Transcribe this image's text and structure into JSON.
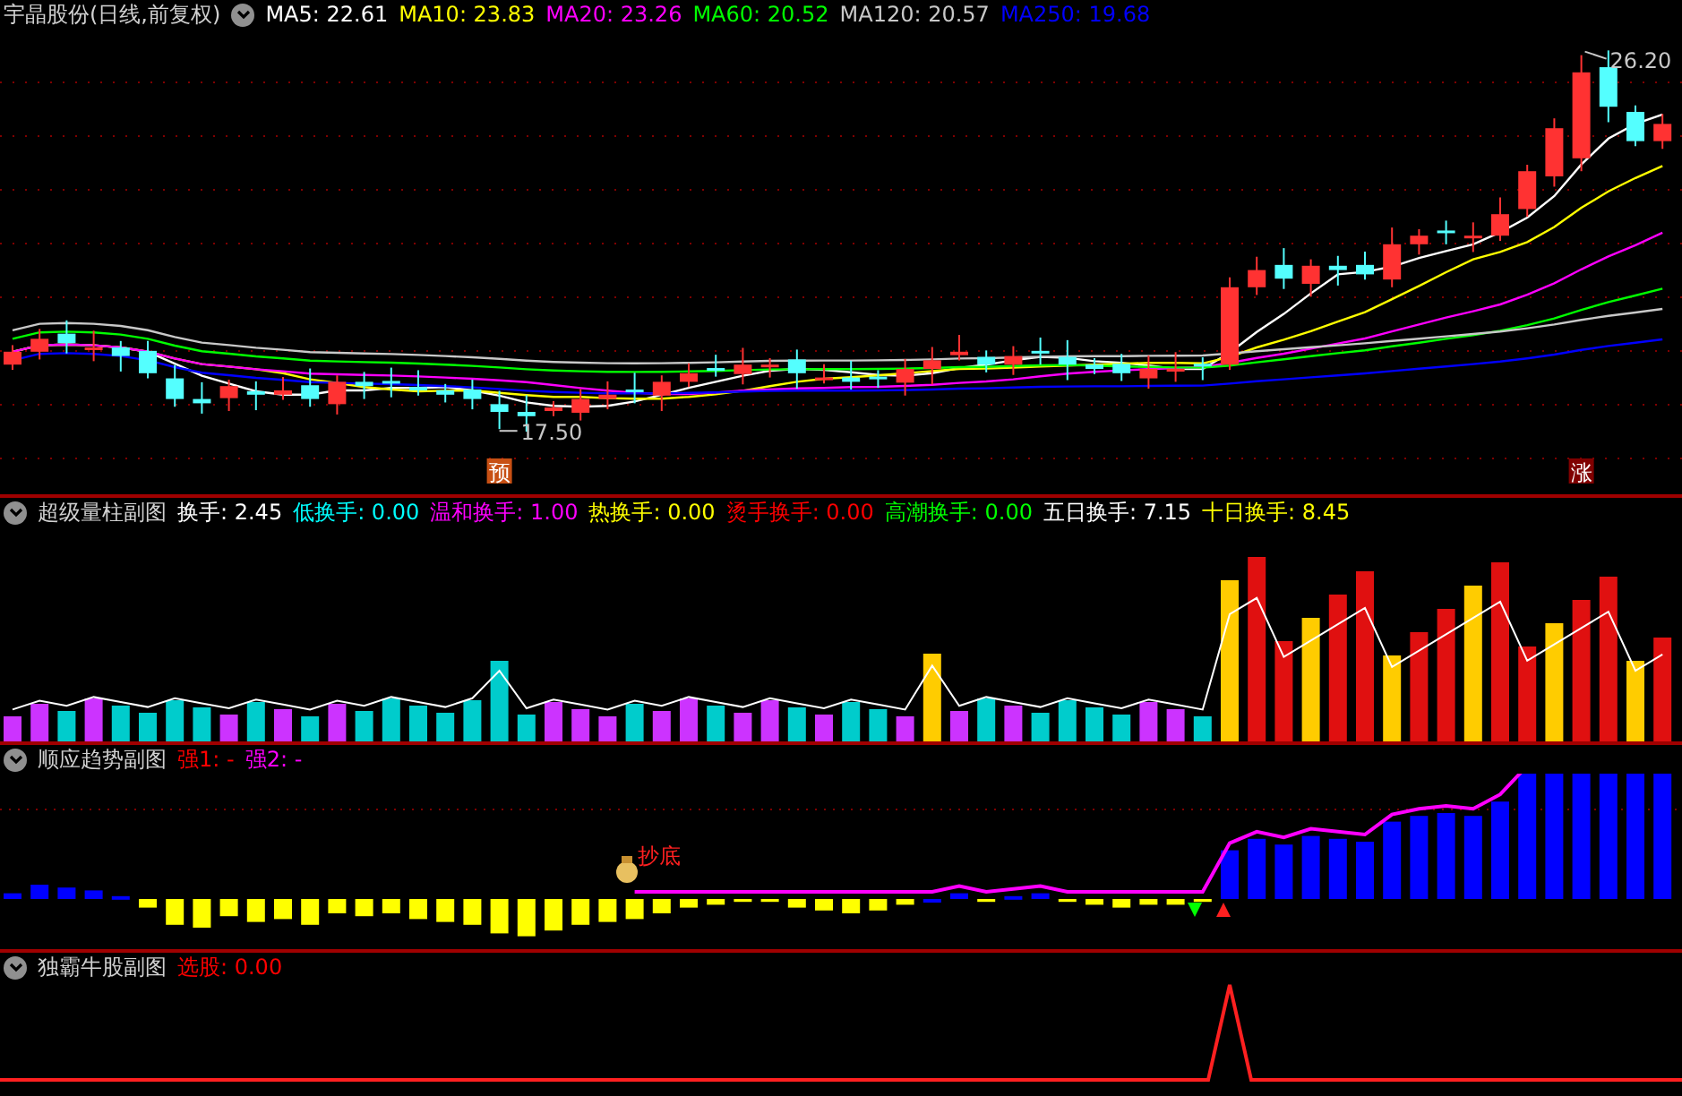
{
  "main_panel": {
    "title": "宇晶股份(日线,前复权)",
    "indicators": [
      {
        "label": "MA5: 22.61",
        "color": "#ffffff"
      },
      {
        "label": "MA10: 23.83",
        "color": "#ffff00"
      },
      {
        "label": "MA20: 23.26",
        "color": "#ff00ff"
      },
      {
        "label": "MA60: 20.52",
        "color": "#00ff00"
      },
      {
        "label": "MA120: 20.57",
        "color": "#c8c8c8"
      },
      {
        "label": "MA250: 19.68",
        "color": "#0000ff"
      }
    ],
    "high_label": "26.20",
    "low_label": "17.50",
    "markers": [
      {
        "text": "预",
        "color": "#c85014"
      },
      {
        "text": "涨",
        "color": "#800000"
      }
    ]
  },
  "sub_panels": [
    {
      "title": "超级量柱副图",
      "readings": [
        {
          "label": "换手: 2.45",
          "color": "#ffffff"
        },
        {
          "label": "低换手: 0.00",
          "color": "#00ffff"
        },
        {
          "label": "温和换手: 1.00",
          "color": "#ff00ff"
        },
        {
          "label": "热换手: 0.00",
          "color": "#ffff00"
        },
        {
          "label": "烫手换手: 0.00",
          "color": "#ff0000"
        },
        {
          "label": "高潮换手: 0.00",
          "color": "#00ff00"
        },
        {
          "label": "五日换手: 7.15",
          "color": "#ffffff"
        },
        {
          "label": "十日换手: 8.45",
          "color": "#ffff00"
        }
      ]
    },
    {
      "title": "顺应趋势副图",
      "readings": [
        {
          "label": "强1: -",
          "color": "#ff0000"
        },
        {
          "label": "强2: -",
          "color": "#ff00ff"
        }
      ],
      "signal_label": "抄底"
    },
    {
      "title": "独霸牛股副图",
      "readings": [
        {
          "label": "选股: 0.00",
          "color": "#ff0000"
        }
      ]
    }
  ]
}
